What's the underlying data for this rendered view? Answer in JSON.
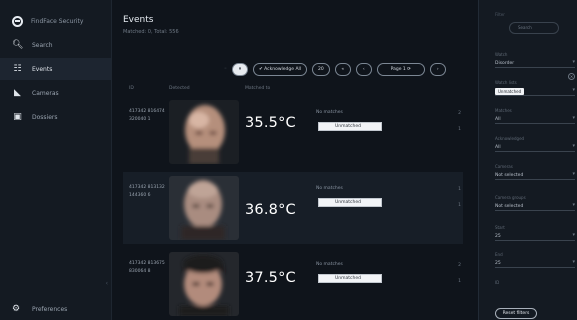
{
  "sidebar": {
    "brand": "FindFace Security",
    "items": [
      {
        "label": "Search",
        "icon": "search-icon"
      },
      {
        "label": "Events",
        "icon": "events-icon"
      },
      {
        "label": "Cameras",
        "icon": "camera-icon"
      },
      {
        "label": "Dossiers",
        "icon": "dossier-icon"
      }
    ],
    "bottom": {
      "label": "Preferences",
      "icon": "gear-icon"
    }
  },
  "main": {
    "title": "Events",
    "subtitle": "Matched: 0, Total: 556",
    "toolbar": {
      "pause_label": "⏸",
      "acknowledge_label": "✔ Acknowledge All",
      "per_page": "20",
      "page_label": "Page 1 ⟳"
    },
    "headers": {
      "id": "ID",
      "detected": "Detected",
      "matched": "Matched to"
    },
    "events": [
      {
        "id": "417342 816474 320040 1",
        "temperature": "35.5°C",
        "match": "No matches",
        "status": "Unmatched",
        "marks": "2\n \n1"
      },
      {
        "id": "417342 813132 144360 6",
        "temperature": "36.8°C",
        "match": "No matches",
        "status": "Unmatched",
        "marks": "1\n \n1"
      },
      {
        "id": "417342 813675 830064 8",
        "temperature": "37.5°C",
        "match": "No matches",
        "status": "Unmatched",
        "marks": "2\n \n1"
      }
    ]
  },
  "filters": {
    "header": "Filter",
    "search_placeholder": "Search",
    "items": [
      {
        "label": "Watch",
        "value": "Disorder"
      },
      {
        "label": "Watch lists",
        "value": "Unmatched"
      },
      {
        "label": "Matches",
        "value": "All"
      },
      {
        "label": "Acknowledged",
        "value": "All"
      },
      {
        "label": "Cameras",
        "value": "Not selected"
      },
      {
        "label": "Camera groups",
        "value": "Not selected"
      },
      {
        "label": "Start",
        "value": "25"
      },
      {
        "label": "End",
        "value": "25"
      },
      {
        "label": "ID",
        "value": ""
      }
    ],
    "reset_label": "Reset filters"
  },
  "colors": {
    "background": "#0f141b",
    "sidebar": "#141a22",
    "row_alt": "#171e27",
    "accent": "#e7ebf0"
  }
}
